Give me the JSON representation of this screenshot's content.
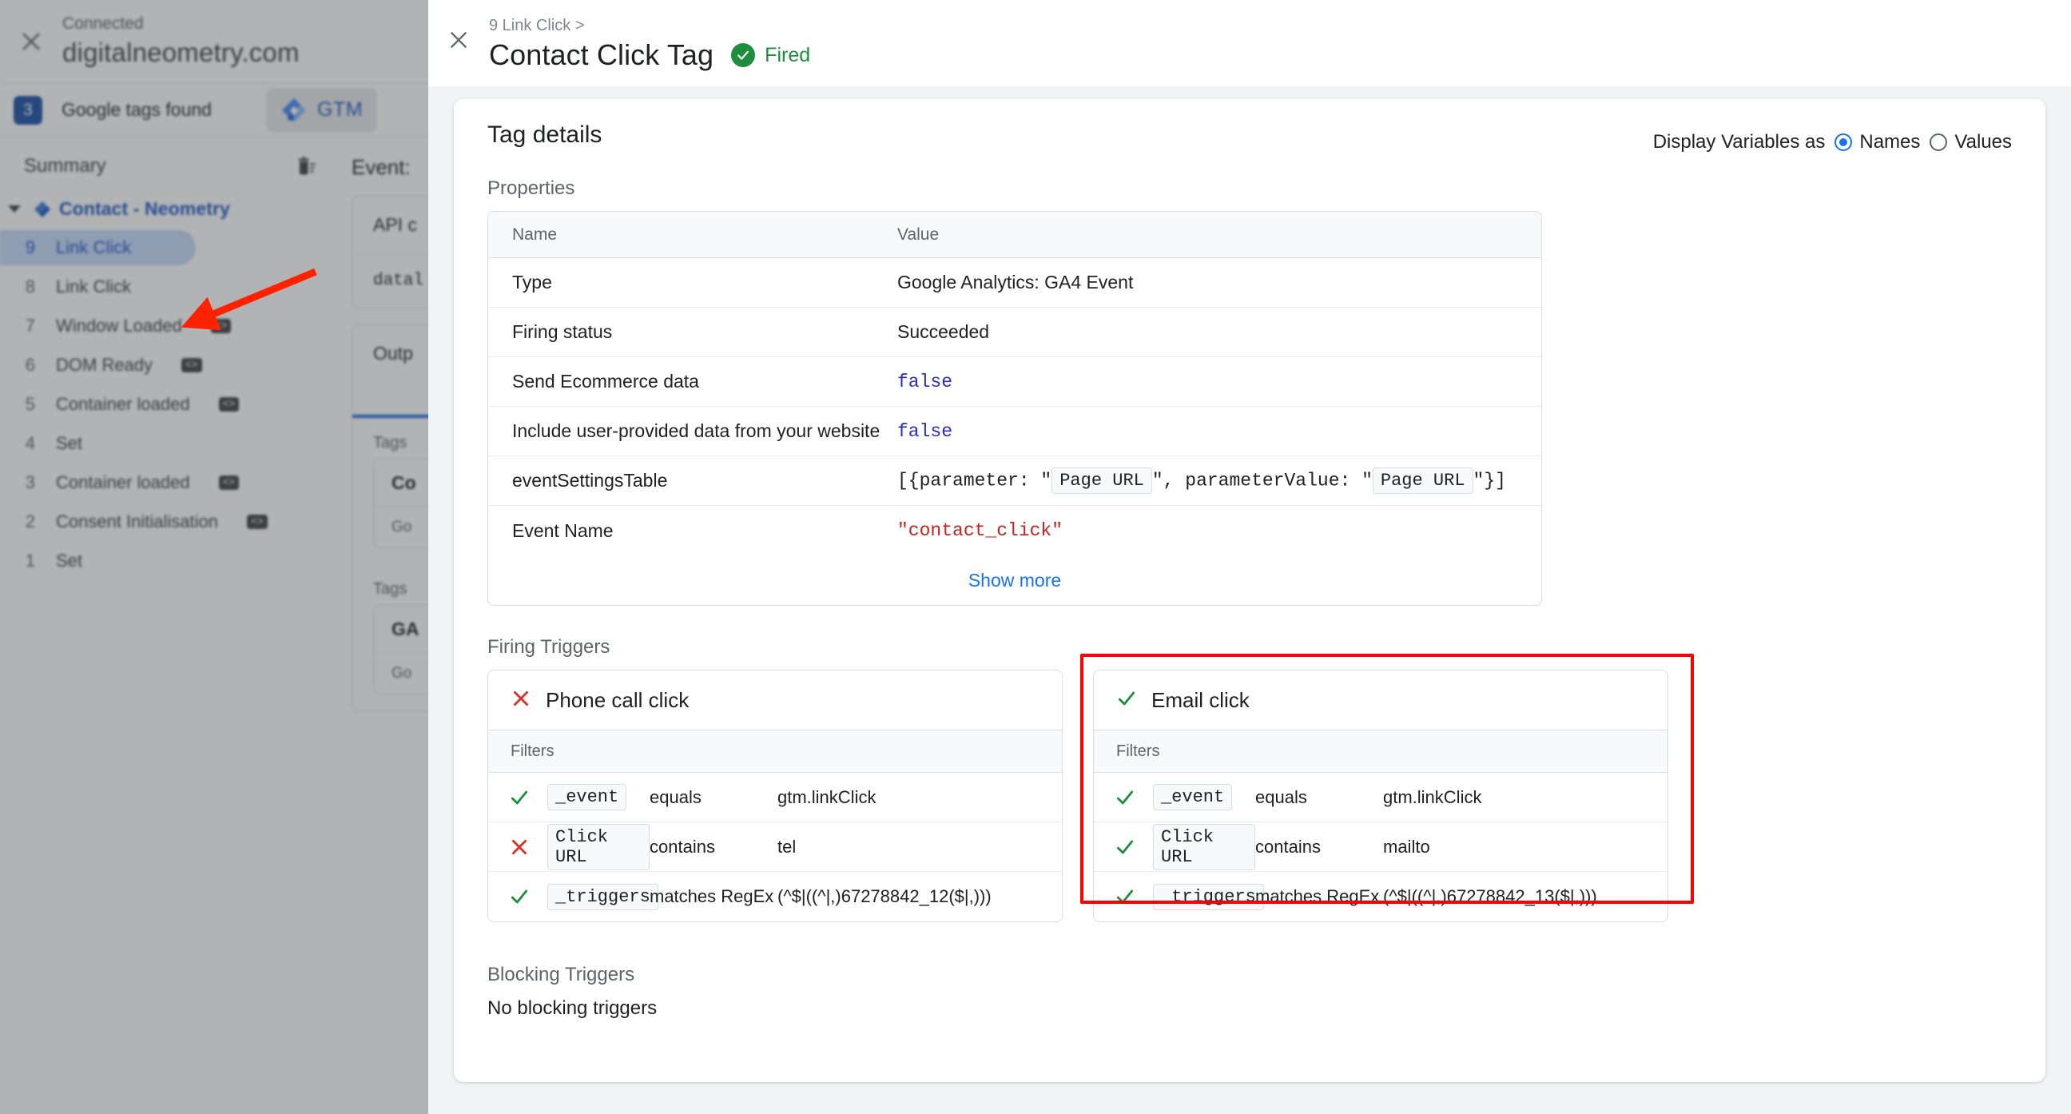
{
  "background": {
    "connected_label": "Connected",
    "domain": "digitalneometry.com",
    "tags_count": "3",
    "tags_found_label": "Google tags found",
    "gtm_chip_label": "GTM",
    "summary_label": "Summary",
    "group_label": "Contact - Neometry",
    "events": [
      {
        "num": "9",
        "name": "Link Click",
        "badge": "",
        "selected": true
      },
      {
        "num": "8",
        "name": "Link Click",
        "badge": "",
        "selected": false
      },
      {
        "num": "7",
        "name": "Window Loaded",
        "badge": "<>",
        "selected": false
      },
      {
        "num": "6",
        "name": "DOM Ready",
        "badge": "<>",
        "selected": false
      },
      {
        "num": "5",
        "name": "Container loaded",
        "badge": "<>",
        "selected": false
      },
      {
        "num": "4",
        "name": "Set",
        "badge": "",
        "selected": false
      },
      {
        "num": "3",
        "name": "Container loaded",
        "badge": "<>",
        "selected": false
      },
      {
        "num": "2",
        "name": "Consent Initialisation",
        "badge": "<>",
        "selected": false
      },
      {
        "num": "1",
        "name": "Set",
        "badge": "",
        "selected": false
      }
    ],
    "main_title": "Event:",
    "card1_row1": "API c",
    "card1_row2": "datal",
    "card2_title": "Outp",
    "tags_label_1": "Tags",
    "tag1_name": "Co",
    "tag1_type": "Go",
    "tags_label_2": "Tags",
    "tag2_name": "GA",
    "tag2_type": "Go"
  },
  "modal": {
    "breadcrumb": "9 Link Click >",
    "title": "Contact Click Tag",
    "status": "Fired",
    "status_color": "#1e8e3e",
    "tag_details_title": "Tag details",
    "display_variables_label": "Display Variables as",
    "display_option_names": "Names",
    "display_option_values": "Values",
    "display_selected": "Names",
    "properties_label": "Properties",
    "properties_table": {
      "headers": [
        "Name",
        "Value"
      ],
      "rows": [
        {
          "name": "Type",
          "value": "Google Analytics: GA4 Event",
          "style": "plain"
        },
        {
          "name": "Firing status",
          "value": "Succeeded",
          "style": "plain"
        },
        {
          "name": "Send Ecommerce data",
          "value": "false",
          "style": "blue"
        },
        {
          "name": "Include user-provided data from your website",
          "value": "false",
          "style": "blue"
        },
        {
          "name": "eventSettingsTable",
          "value": "",
          "style": "eventsettings"
        },
        {
          "name": "Event Name",
          "value": "\"contact_click\"",
          "style": "red"
        }
      ],
      "event_settings": {
        "prefix": "[{parameter: \"",
        "chip1": "Page URL",
        "middle": "\", parameterValue: \"",
        "chip2": "Page URL",
        "suffix": "\"}]"
      },
      "show_more": "Show more"
    },
    "firing_triggers_label": "Firing Triggers",
    "triggers": [
      {
        "name": "Phone call click",
        "status": "x",
        "filters_label": "Filters",
        "filters": [
          {
            "status": "check",
            "variable": "_event",
            "operator": "equals",
            "value": "gtm.linkClick"
          },
          {
            "status": "x",
            "variable": "Click URL",
            "operator": "contains",
            "value": "tel"
          },
          {
            "status": "check",
            "variable": "_triggers",
            "operator": "matches RegEx",
            "value": "(^$|((^|,)67278842_12($|,)))"
          }
        ],
        "highlighted": false
      },
      {
        "name": "Email click",
        "status": "check",
        "filters_label": "Filters",
        "filters": [
          {
            "status": "check",
            "variable": "_event",
            "operator": "equals",
            "value": "gtm.linkClick"
          },
          {
            "status": "check",
            "variable": "Click URL",
            "operator": "contains",
            "value": "mailto"
          },
          {
            "status": "check",
            "variable": "_triggers",
            "operator": "matches RegEx",
            "value": "(^$|((^|,)67278842_13($|,)))"
          }
        ],
        "highlighted": true
      }
    ],
    "blocking_triggers_label": "Blocking Triggers",
    "blocking_triggers_text": "No blocking triggers"
  },
  "annotation": {
    "arrow_color": "#ff2200",
    "highlight_color": "#ff0000"
  }
}
